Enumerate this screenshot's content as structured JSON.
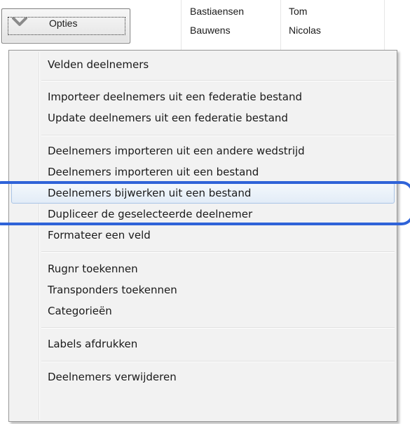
{
  "background_table": {
    "rows": [
      {
        "last_name": "Bastiaensen",
        "first_name": "Tom"
      },
      {
        "last_name": "Bauwens",
        "first_name": "Nicolas"
      }
    ]
  },
  "options_button": {
    "label": "Opties",
    "icon": "chevron-down-icon"
  },
  "menu": {
    "groups": [
      [
        "Velden deelnemers"
      ],
      [
        "Importeer deelnemers uit een federatie bestand",
        "Update deelnemers uit een federatie bestand"
      ],
      [
        "Deelnemers importeren uit een andere wedstrijd",
        "Deelnemers importeren uit een bestand",
        "Deelnemers bijwerken uit een bestand",
        "Dupliceer de geselecteerde deelnemer",
        "Formateer een veld"
      ],
      [
        "Rugnr toekennen",
        "Transponders toekennen",
        "Categorieën"
      ],
      [
        "Labels afdrukken"
      ],
      [
        "Deelnemers verwijderen"
      ]
    ],
    "highlighted_item": "Deelnemers bijwerken uit een bestand"
  },
  "colors": {
    "annotation_ring": "#2f63d8",
    "highlight_border": "#a9c4e6",
    "menu_background": "#f2f2f2"
  }
}
